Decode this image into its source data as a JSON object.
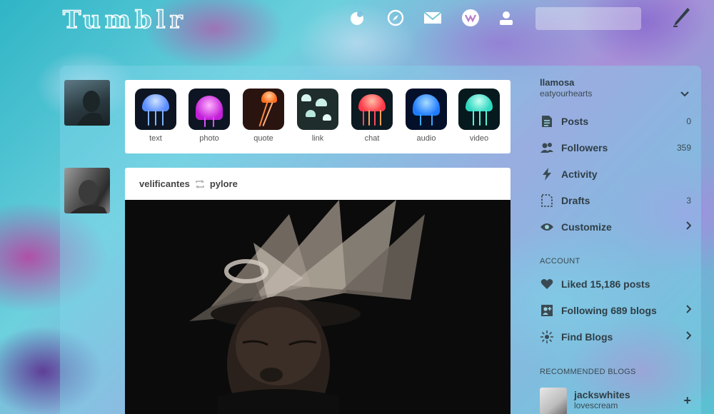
{
  "header": {
    "logo": "Tumblr",
    "search_placeholder": "",
    "icons": [
      "home-icon",
      "explore-icon",
      "mail-icon",
      "activity-icon",
      "account-icon",
      "compose-icon"
    ]
  },
  "post_types": [
    {
      "label": "text",
      "color": "#7fb2ff"
    },
    {
      "label": "photo",
      "color": "#e04cff"
    },
    {
      "label": "quote",
      "color": "#ff8a3c"
    },
    {
      "label": "link",
      "color": "#c9efe6"
    },
    {
      "label": "chat",
      "color": "#ff4a5a"
    },
    {
      "label": "audio",
      "color": "#3fa8ff"
    },
    {
      "label": "video",
      "color": "#59f0d8"
    }
  ],
  "post": {
    "author": "velificantes",
    "reblogged_from": "pylore"
  },
  "sidebar": {
    "username": "llamosa",
    "subtitle": "eatyourhearts",
    "items": [
      {
        "label": "Posts",
        "count": "0"
      },
      {
        "label": "Followers",
        "count": "359"
      },
      {
        "label": "Activity",
        "count": ""
      },
      {
        "label": "Drafts",
        "count": "3"
      },
      {
        "label": "Customize",
        "count": ""
      }
    ],
    "account_heading": "ACCOUNT",
    "account_items": [
      {
        "label": "Liked 15,186 posts"
      },
      {
        "label": "Following 689 blogs"
      },
      {
        "label": "Find Blogs"
      }
    ],
    "recommended_heading": "RECOMMENDED BLOGS",
    "recommended": [
      {
        "name": "jackswhites",
        "subtitle": "lovescream"
      }
    ]
  }
}
